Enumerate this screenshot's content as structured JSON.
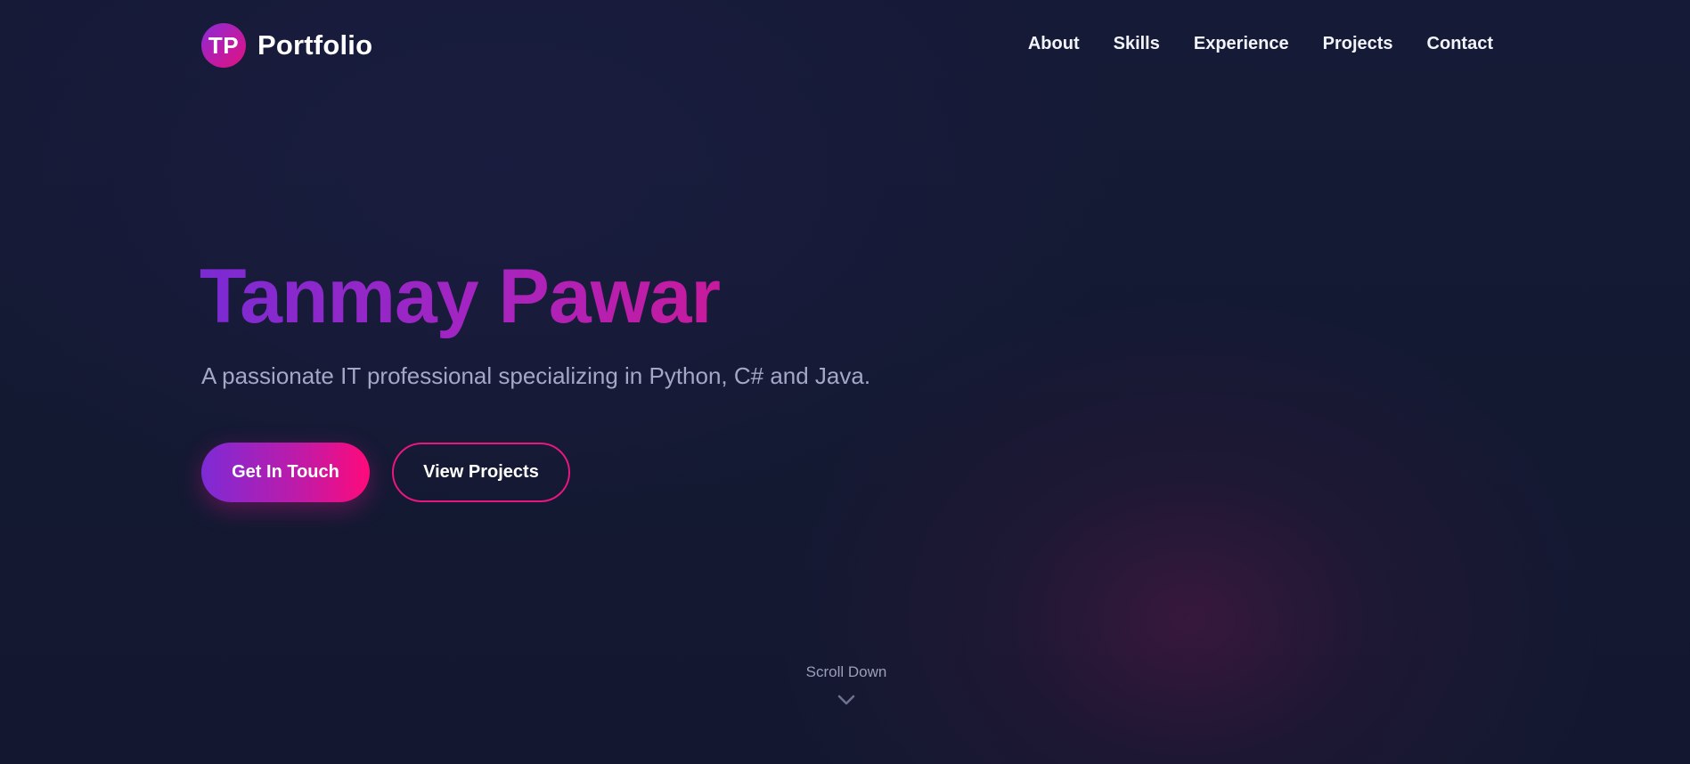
{
  "header": {
    "logo_initials": "TP",
    "brand": "Portfolio",
    "nav": [
      "About",
      "Skills",
      "Experience",
      "Projects",
      "Contact"
    ]
  },
  "hero": {
    "name": "Tanmay Pawar",
    "tagline": "A passionate IT professional specializing in Python, C# and Java.",
    "primary_button": "Get In Touch",
    "secondary_button": "View Projects"
  },
  "scroll": {
    "label": "Scroll Down",
    "icon": "chevron-down-icon"
  },
  "colors": {
    "background": "#141932",
    "accent_purple": "#7b2bd3",
    "accent_pink": "#ff0a7a",
    "muted_text": "#a3a8c6"
  }
}
